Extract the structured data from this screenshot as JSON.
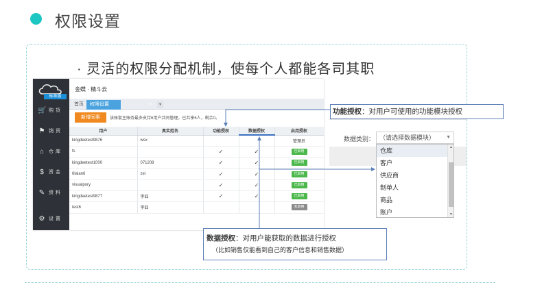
{
  "slide": {
    "title": "权限设置",
    "subtitle": "· 灵活的权限分配机制，使每个人都能各司其职"
  },
  "app": {
    "brand": "金蝶 · 精斗云",
    "badge": "标准版",
    "nav": [
      {
        "icon": "cart-icon",
        "label": "购货"
      },
      {
        "icon": "sales-icon",
        "label": "销货"
      },
      {
        "icon": "warehouse-icon",
        "label": "仓库"
      },
      {
        "icon": "money-icon",
        "label": "资金"
      },
      {
        "icon": "pen-icon",
        "label": "资料"
      },
      {
        "icon": "gear-icon",
        "label": "设置"
      }
    ],
    "tabs": {
      "home": "首页",
      "permission": "权限设置",
      "close": "×",
      "more": "▾"
    },
    "add_button": "新增同事",
    "notice": "该账套主账务最多支持6用户共同管理，已共享6人，剩余0。",
    "columns": [
      "用户",
      "真实姓名",
      "功能授权",
      "数据授权",
      "启用授权"
    ],
    "rows": [
      {
        "user": "kingdeetest9876",
        "name": "wsx",
        "func": "",
        "data": "",
        "status": "管理员",
        "type": "role"
      },
      {
        "user": "fs",
        "name": "",
        "func": "✓",
        "data": "✓",
        "status": "已启用",
        "type": "on"
      },
      {
        "user": "kingdeetest1000",
        "name": "071208",
        "func": "✓",
        "data": "✓",
        "status": "已启用",
        "type": "on"
      },
      {
        "user": "6lalan6",
        "name": "zei",
        "func": "✓",
        "data": "✓",
        "status": "已启用",
        "type": "on"
      },
      {
        "user": "visualpory",
        "name": "",
        "func": "✓",
        "data": "✓",
        "status": "已启用",
        "type": "on"
      },
      {
        "user": "kingdeetest9877",
        "name": "李四",
        "func": "✓",
        "data": "✓",
        "status": "已启用",
        "type": "on"
      },
      {
        "user": "test6",
        "name": "李四",
        "func": "",
        "data": "",
        "status": "未启用",
        "type": "off"
      }
    ]
  },
  "data_panel": {
    "label": "数据类别：",
    "placeholder": "（请选择数据模块）",
    "options": [
      "仓库",
      "客户",
      "供应商",
      "制单人",
      "商品",
      "账户"
    ]
  },
  "callouts": {
    "function_title": "功能授权",
    "function_text": "：对用户可使用的功能模块授权",
    "data_title": "数据授权",
    "data_text": "：对用户能获取的数据进行授权",
    "data_note": "（比如销售仅能看到自己的客户信息和销售数据）"
  },
  "colors": {
    "accent": "#1cc7c1",
    "orange": "#f08a20",
    "blue": "#4aa3df",
    "green": "#4cb84c",
    "sidebar": "#2e3238"
  }
}
